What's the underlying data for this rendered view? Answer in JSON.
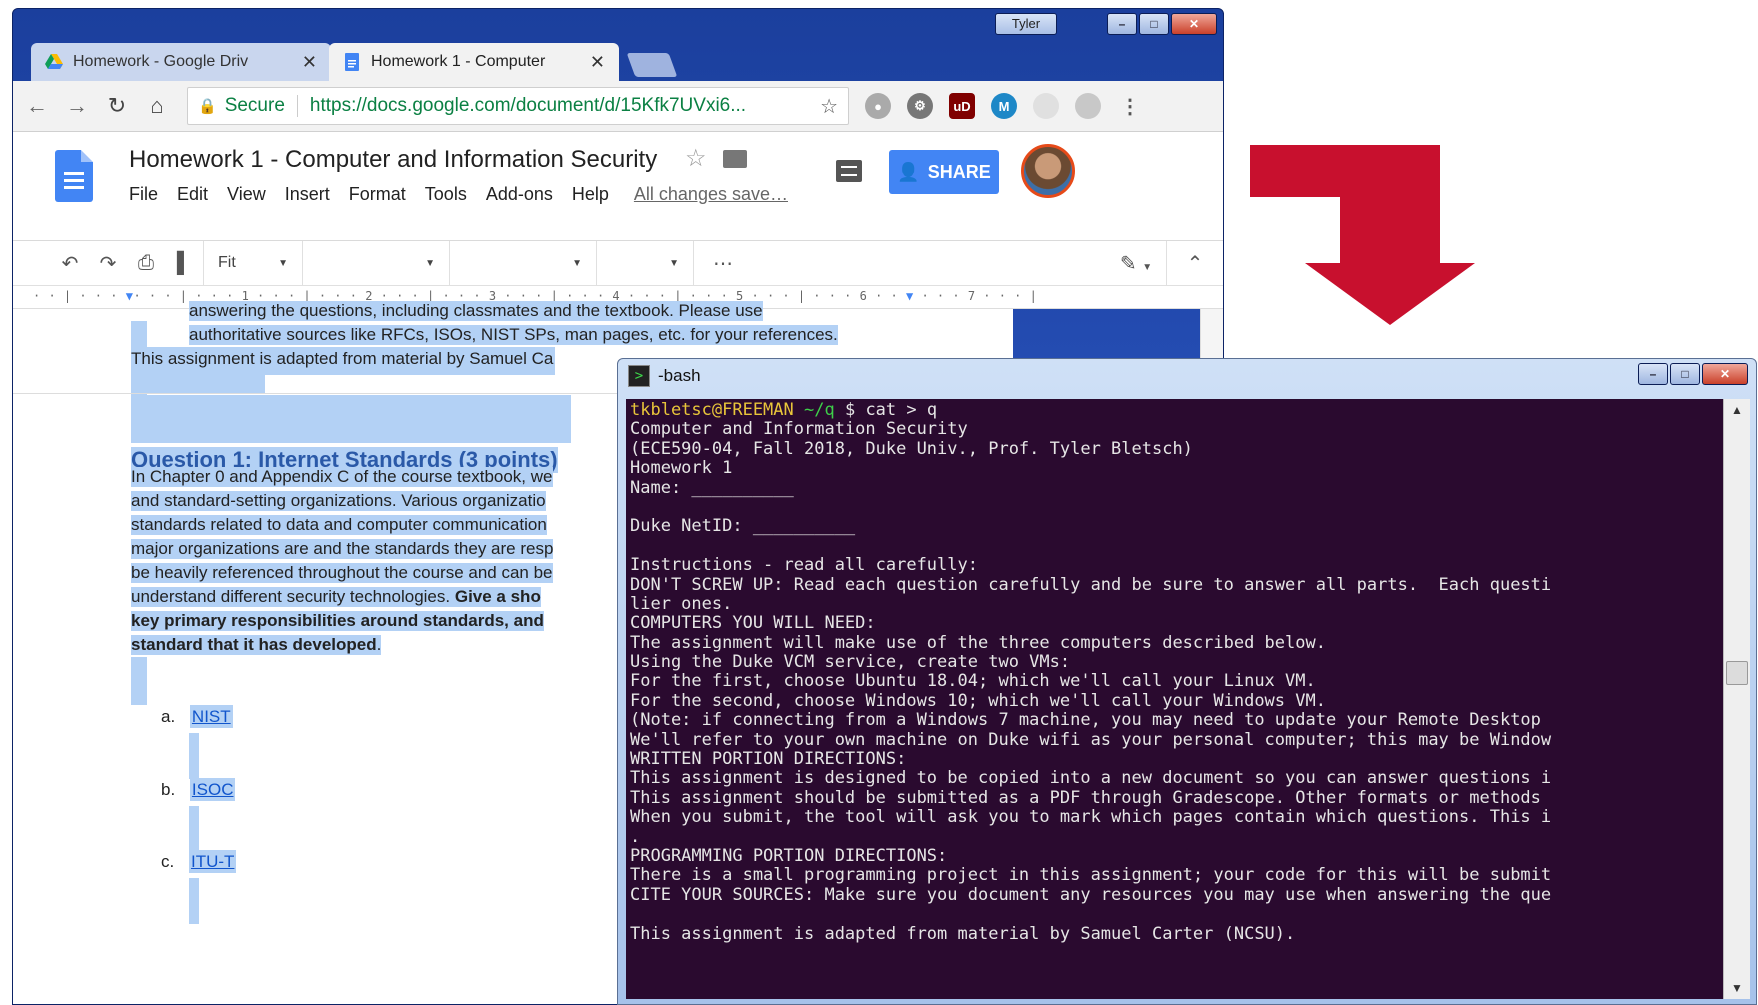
{
  "chrome": {
    "profile_name": "Tyler",
    "tabs": [
      {
        "title": "Homework - Google Driv",
        "active": false
      },
      {
        "title": "Homework 1 - Computer",
        "active": true
      }
    ],
    "omnibox": {
      "secure_label": "Secure",
      "url": "https://docs.google.com/document/d/15Kfk7UVxi6..."
    }
  },
  "docs": {
    "title": "Homework 1 - Computer and Information Security",
    "menu": [
      "File",
      "Edit",
      "View",
      "Insert",
      "Format",
      "Tools",
      "Add-ons",
      "Help"
    ],
    "save_status": "All changes save…",
    "share_label": "SHARE",
    "zoom": "Fit",
    "ruler_numbers": [
      "1",
      "2",
      "3",
      "4",
      "5",
      "6",
      "7"
    ],
    "body": {
      "line1": "answering the questions, including classmates and the textbook.  Please use",
      "line2": "authoritative sources like RFCs, ISOs, NIST SPs, man pages, etc. for your references.",
      "adapted": "This assignment is adapted from material by Samuel Ca",
      "question_heading": "Question 1: Internet Standards (3 points)",
      "para": [
        "In Chapter 0 and Appendix C of the course textbook, we",
        "and standard-setting organizations.  Various organizatio",
        "standards related to data and computer communication",
        "major organizations are and the standards they are resp",
        "be heavily referenced throughout the course and can be",
        "understand different security technologies.  "
      ],
      "para_bold_tail": "Give a sho",
      "para_bold2": "key primary responsibilities around standards, and",
      "para_bold3": "standard that it has developed",
      "para_bold3_end": "."
    },
    "list": [
      {
        "marker": "a.",
        "label": "NIST"
      },
      {
        "marker": "b.",
        "label": "ISOC"
      },
      {
        "marker": "c.",
        "label": "ITU-T"
      }
    ]
  },
  "terminal": {
    "title": "-bash",
    "prompt_user": "tkbletsc@FREEMAN",
    "prompt_path": "~/q",
    "prompt_cmd": " $ cat > q",
    "lines": [
      "Computer and Information Security",
      "(ECE590-04, Fall 2018, Duke Univ., Prof. Tyler Bletsch)",
      "Homework 1",
      "Name: __________",
      "",
      "Duke NetID: __________",
      "",
      "Instructions - read all carefully:",
      "DON'T SCREW UP: Read each question carefully and be sure to answer all parts.  Each questi",
      "lier ones.",
      "COMPUTERS YOU WILL NEED:",
      "The assignment will make use of the three computers described below.",
      "Using the Duke VCM service, create two VMs:",
      "For the first, choose Ubuntu 18.04; which we'll call your Linux VM.",
      "For the second, choose Windows 10; which we'll call your Windows VM.",
      "(Note: if connecting from a Windows 7 machine, you may need to update your Remote Desktop",
      "We'll refer to your own machine on Duke wifi as your personal computer; this may be Window",
      "WRITTEN PORTION DIRECTIONS:",
      "This assignment is designed to be copied into a new document so you can answer questions i",
      "This assignment should be submitted as a PDF through Gradescope. Other formats or methods",
      "When you submit, the tool will ask you to mark which pages contain which questions. This i",
      ".",
      "PROGRAMMING PORTION DIRECTIONS:",
      "There is a small programming project in this assignment; your code for this will be submit",
      "CITE YOUR SOURCES: Make sure you document any resources you may use when answering the que",
      "",
      "This assignment is adapted from material by Samuel Carter (NCSU)."
    ]
  },
  "colors": {
    "arrow": "#c8102e",
    "terminal_bg": "#2a0a2f",
    "docs_blue": "#4285f4",
    "selection": "#b3d1f5"
  }
}
